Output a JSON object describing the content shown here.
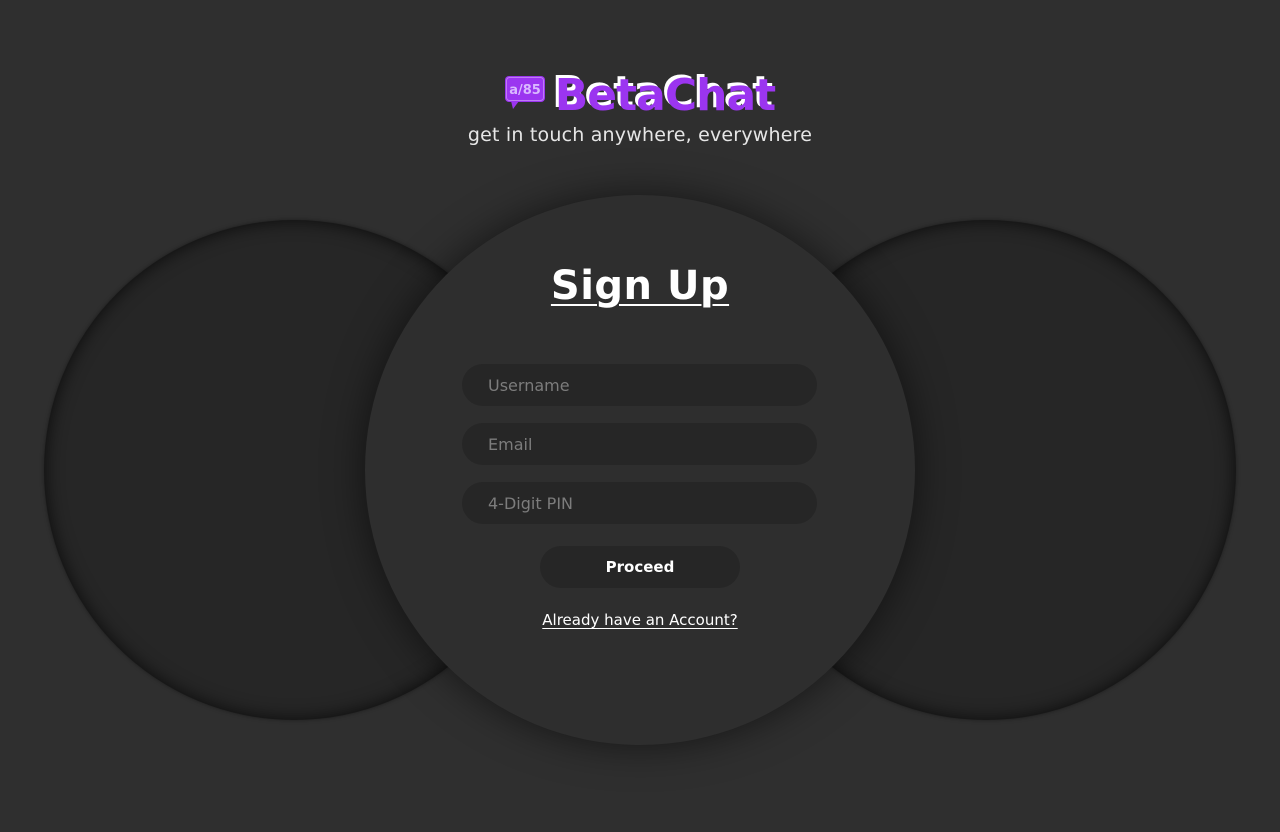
{
  "brand": {
    "name": "BetaChat",
    "tagline": "get in touch anywhere, everywhere",
    "logo_icon": "chat-bubble-icon",
    "logo_mark": "a/85",
    "accent_color": "#9b35f0"
  },
  "form": {
    "heading": "Sign Up",
    "username_placeholder": "Username",
    "email_placeholder": "Email",
    "pin_placeholder": "4-Digit PIN",
    "submit_label": "Proceed",
    "login_link": "Already have an Account?"
  },
  "colors": {
    "background": "#2f2f2f",
    "panel": "#2e2e2e",
    "field": "#262626",
    "text": "#ffffff"
  }
}
